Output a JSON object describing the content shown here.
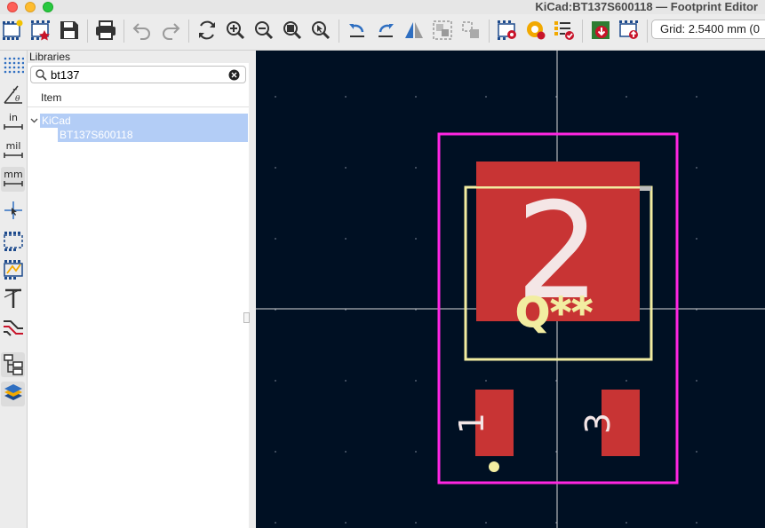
{
  "window": {
    "title": "KiCad:BT137S600118 — Footprint Editor"
  },
  "toolbar": {
    "buttons": [
      "new-footprint",
      "create-with-wizard",
      "save",
      "print",
      "undo",
      "redo",
      "refresh",
      "zoom-in",
      "zoom-out",
      "zoom-fit",
      "zoom-selection",
      "rotate-ccw",
      "rotate-cw",
      "mirror",
      "group",
      "ungroup",
      "footprint-properties",
      "pad-defaults",
      "check-footprint",
      "load-from-board",
      "insert-into-board"
    ],
    "grid_label": "Grid: 2.5400 mm (0"
  },
  "left_toolbar": {
    "in_label": "in",
    "mil_label": "mil",
    "mm_label": "mm",
    "polar_label": "r θ"
  },
  "libraries": {
    "header": "Libraries",
    "search_value": "bt137",
    "column_item": "Item",
    "tree": [
      {
        "label": "KiCad",
        "level": 0,
        "expanded": true,
        "selected": true
      },
      {
        "label": "BT137S600118",
        "level": 1,
        "selected": true
      }
    ]
  },
  "footprint": {
    "reference": "Q**",
    "pads": [
      "2",
      "1",
      "3"
    ]
  },
  "colors": {
    "canvas_bg": "#001023",
    "pad": "#c83434",
    "silkscreen": "#f2eda1",
    "courtyard": "#ff26e2",
    "selection": "#b3cdf6"
  }
}
